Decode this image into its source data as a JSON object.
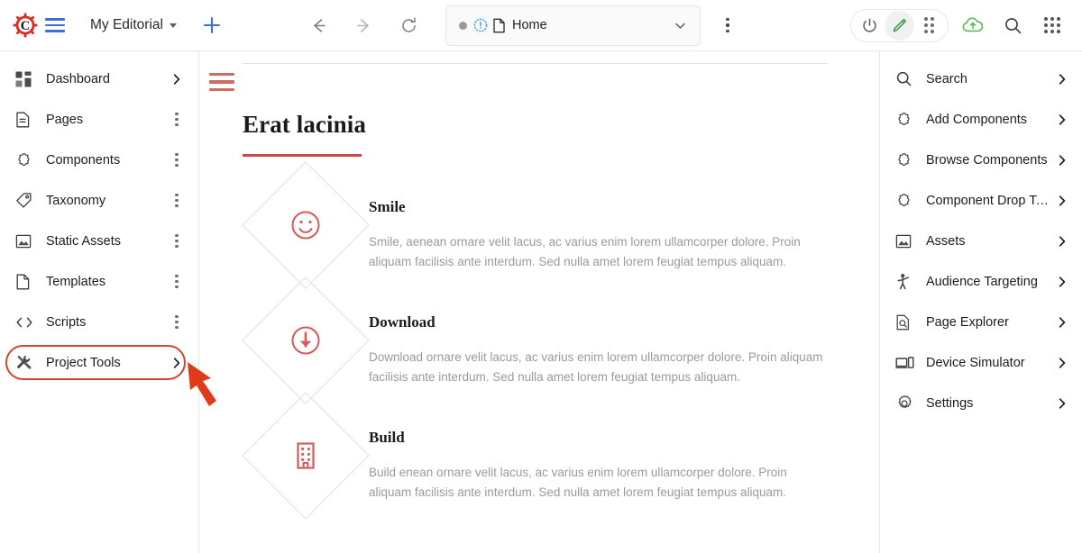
{
  "topbar": {
    "logo_icon": "gear-c-logo",
    "menu_icon": "hamburger-menu-icon",
    "site_name": "My Editorial",
    "site_caret_icon": "chevron-down-icon",
    "add_icon": "plus-icon",
    "back_icon": "arrow-left-icon",
    "forward_icon": "arrow-right-icon",
    "reload_icon": "reload-icon",
    "url": {
      "status_dot": "status-dot",
      "warning_icon": "warning-circle-icon",
      "page_icon": "page-file-icon",
      "text": "Home",
      "chevron_icon": "chevron-down-icon"
    },
    "more_icon": "kebab-menu-icon",
    "pill": {
      "power_icon": "power-icon",
      "edit_icon": "pencil-edit-icon",
      "apps_icon": "dots-grid-icon"
    },
    "cloud_icon": "cloud-upload-icon",
    "search_icon": "search-icon",
    "grid_icon": "app-grid-icon"
  },
  "colors": {
    "accent_red": "#c8484a",
    "annotation_red": "#d1462b",
    "arrow_red": "#e03a1a",
    "logo_red": "#e02b20",
    "brand_blue": "#3b6fd4",
    "edit_green": "#43a047"
  },
  "sidebar": {
    "items": [
      {
        "label": "Dashboard",
        "icon": "dashboard-grid-icon",
        "end": "chevron"
      },
      {
        "label": "Pages",
        "icon": "page-file-icon",
        "end": "kebab"
      },
      {
        "label": "Components",
        "icon": "puzzle-piece-icon",
        "end": "kebab"
      },
      {
        "label": "Taxonomy",
        "icon": "tag-icon",
        "end": "kebab"
      },
      {
        "label": "Static Assets",
        "icon": "image-icon",
        "end": "kebab"
      },
      {
        "label": "Templates",
        "icon": "document-icon",
        "end": "kebab"
      },
      {
        "label": "Scripts",
        "icon": "code-brackets-icon",
        "end": "kebab"
      },
      {
        "label": "Project Tools",
        "icon": "wrench-tools-icon",
        "end": "chevron",
        "highlighted": true
      }
    ]
  },
  "main": {
    "menu_icon": "content-hamburger-icon",
    "heading": "Erat lacinia",
    "features": [
      {
        "title": "Smile",
        "icon": "smiley-face-icon",
        "description": "Smile, aenean ornare velit lacus, ac varius enim lorem ullamcorper dolore. Proin aliquam facilisis ante interdum. Sed nulla amet lorem feugiat tempus aliquam."
      },
      {
        "title": "Download",
        "icon": "download-circle-icon",
        "description": "Download ornare velit lacus, ac varius enim lorem ullamcorper dolore. Proin aliquam facilisis ante interdum. Sed nulla amet lorem feugiat tempus aliquam."
      },
      {
        "title": "Build",
        "icon": "building-icon",
        "description": "Build enean ornare velit lacus, ac varius enim lorem ullamcorper dolore. Proin aliquam facilisis ante interdum. Sed nulla amet lorem feugiat tempus aliquam."
      }
    ]
  },
  "right_panel": {
    "items": [
      {
        "label": "Search",
        "icon": "search-icon"
      },
      {
        "label": "Add Components",
        "icon": "puzzle-piece-icon"
      },
      {
        "label": "Browse Components",
        "icon": "puzzle-piece-icon"
      },
      {
        "label": "Component Drop Ta…",
        "icon": "puzzle-piece-icon"
      },
      {
        "label": "Assets",
        "icon": "image-icon"
      },
      {
        "label": "Audience Targeting",
        "icon": "person-target-icon"
      },
      {
        "label": "Page Explorer",
        "icon": "page-search-icon"
      },
      {
        "label": "Device Simulator",
        "icon": "device-simulator-icon"
      },
      {
        "label": "Settings",
        "icon": "gear-icon"
      }
    ]
  },
  "annotations": {
    "highlight_target": "Project Tools",
    "arrow_icon": "pointer-arrow-annotation"
  }
}
